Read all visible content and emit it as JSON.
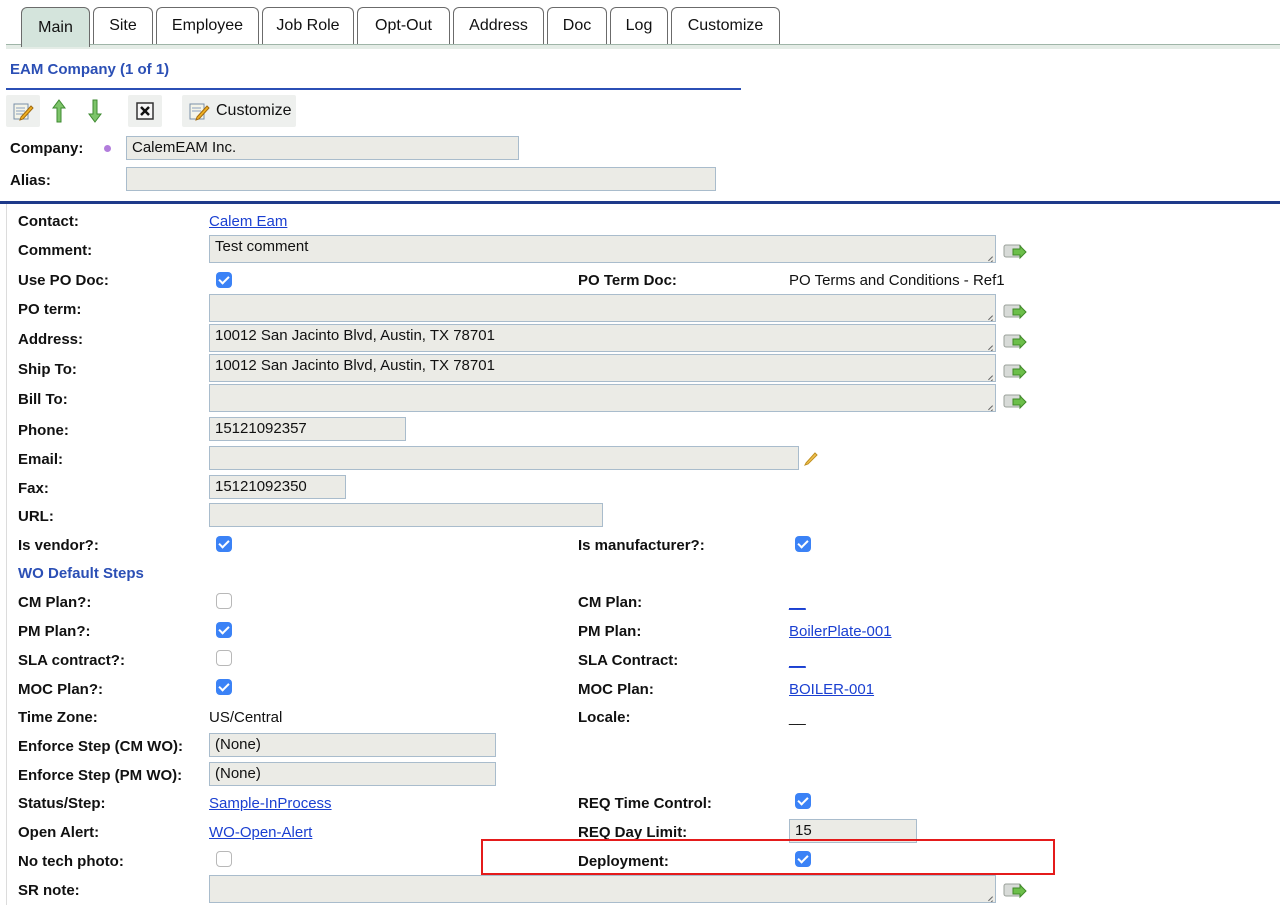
{
  "tabs": [
    "Main",
    "Site",
    "Employee",
    "Job Role",
    "Opt-Out",
    "Address",
    "Doc",
    "Log",
    "Customize"
  ],
  "header": {
    "title": "EAM Company (1 of 1)"
  },
  "toolbar": {
    "customize_label": "Customize"
  },
  "company": {
    "label": "Company:",
    "value": "CalemEAM Inc."
  },
  "alias": {
    "label": "Alias:",
    "value": ""
  },
  "fields": {
    "contact": {
      "label": "Contact:",
      "value": "Calem Eam"
    },
    "comment": {
      "label": "Comment:",
      "value": "Test comment"
    },
    "use_po_doc": {
      "label": "Use PO Doc:",
      "checked": true
    },
    "po_term_doc": {
      "label": "PO Term Doc:",
      "value": "PO Terms and Conditions - Ref1"
    },
    "po_term": {
      "label": "PO term:",
      "value": ""
    },
    "address": {
      "label": "Address:",
      "value": "10012 San Jacinto Blvd, Austin, TX 78701"
    },
    "ship_to": {
      "label": "Ship To:",
      "value": "10012 San Jacinto Blvd, Austin, TX 78701"
    },
    "bill_to": {
      "label": "Bill To:",
      "value": ""
    },
    "phone": {
      "label": "Phone:",
      "value": "15121092357"
    },
    "email": {
      "label": "Email:",
      "value": ""
    },
    "fax": {
      "label": "Fax:",
      "value": "15121092350"
    },
    "url": {
      "label": "URL:",
      "value": ""
    },
    "is_vendor": {
      "label": "Is vendor?:",
      "checked": true
    },
    "is_manufacturer": {
      "label": "Is manufacturer?:",
      "checked": true
    }
  },
  "wo_section": {
    "title": "WO Default Steps"
  },
  "wo": {
    "cm_plan_q": {
      "label": "CM Plan?:",
      "checked": false
    },
    "cm_plan": {
      "label": "CM Plan:",
      "value": "__"
    },
    "pm_plan_q": {
      "label": "PM Plan?:",
      "checked": true
    },
    "pm_plan": {
      "label": "PM Plan:",
      "value": "BoilerPlate-001"
    },
    "sla_q": {
      "label": "SLA contract?:",
      "checked": false
    },
    "sla": {
      "label": "SLA Contract:",
      "value": "__"
    },
    "moc_q": {
      "label": "MOC Plan?:",
      "checked": true
    },
    "moc": {
      "label": "MOC Plan:",
      "value": "BOILER-001"
    },
    "time_zone": {
      "label": "Time Zone:",
      "value": "US/Central"
    },
    "locale": {
      "label": "Locale:",
      "value": "__"
    },
    "enforce_cm": {
      "label": "Enforce Step (CM WO):",
      "value": "(None)"
    },
    "enforce_pm": {
      "label": "Enforce Step (PM WO):",
      "value": "(None)"
    },
    "status_step": {
      "label": "Status/Step:",
      "value": "Sample-InProcess"
    },
    "req_time_control": {
      "label": "REQ Time Control:",
      "checked": true
    },
    "open_alert": {
      "label": "Open Alert:",
      "value": "WO-Open-Alert"
    },
    "req_day_limit": {
      "label": "REQ Day Limit:",
      "value": "15"
    },
    "no_tech_photo": {
      "label": "No tech photo:",
      "checked": false
    },
    "deployment": {
      "label": "Deployment:",
      "checked": true
    },
    "sr_note": {
      "label": "SR note:",
      "value": ""
    }
  },
  "colors": {
    "accent": "#2b4fb5",
    "link": "#1a3fd1",
    "checkbox": "#3b82f6",
    "highlight": "#e41b1b",
    "field_bg": "#ebebe6"
  }
}
